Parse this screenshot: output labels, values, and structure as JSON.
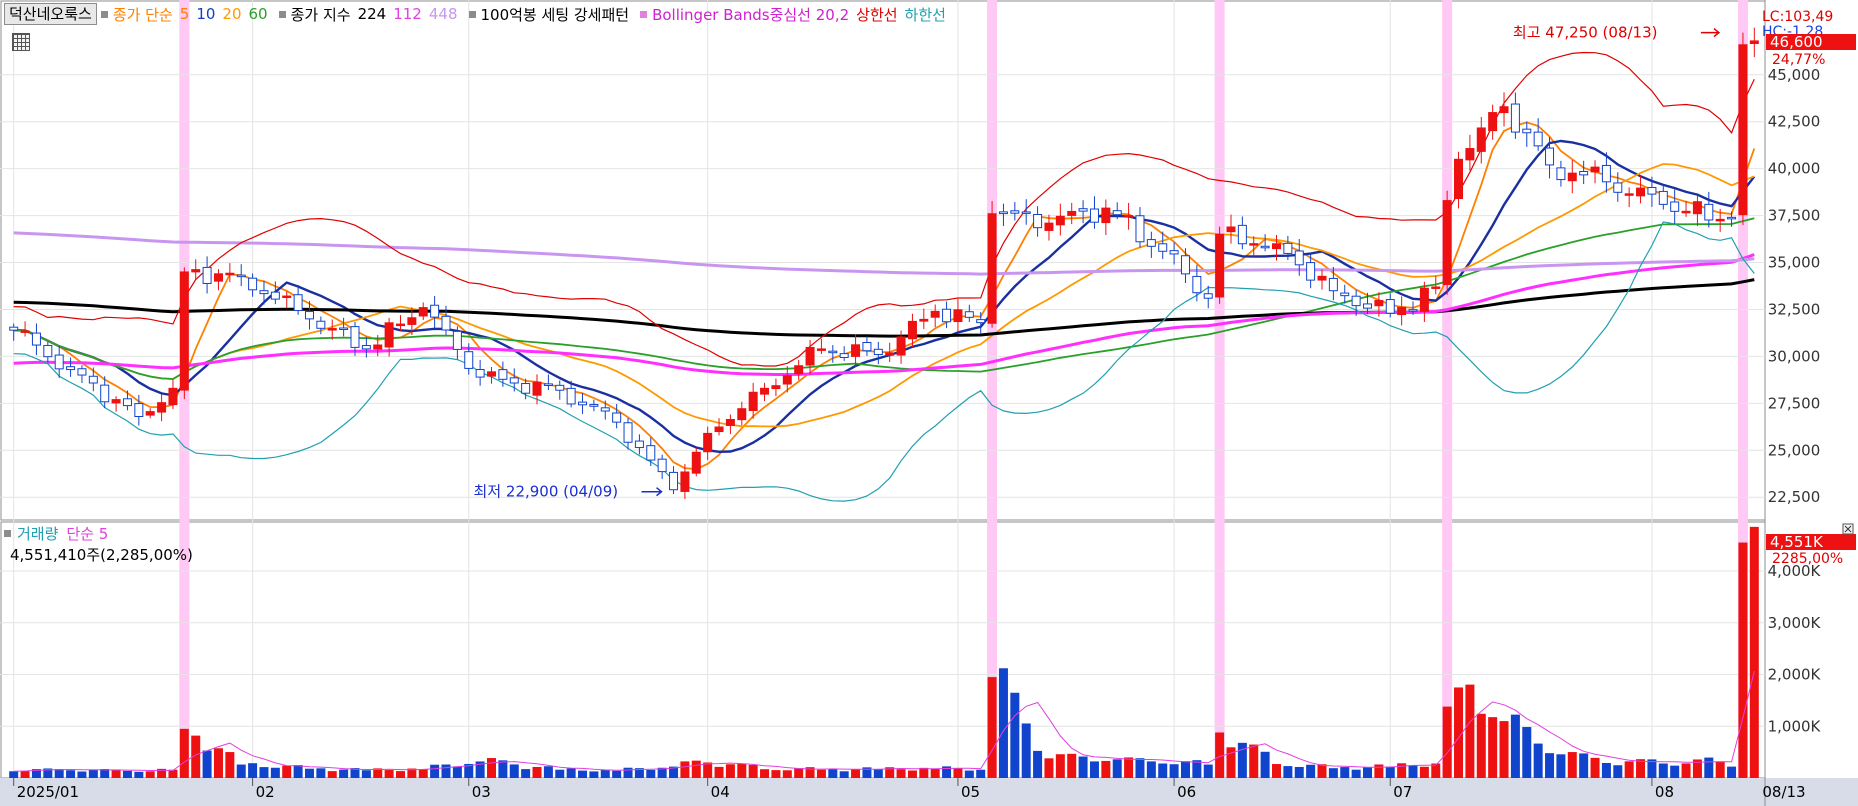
{
  "indicators": {
    "stock_name": "덕산네오룩스",
    "ma_label": "종가 단순",
    "ma_periods": [
      {
        "text": "5",
        "color": "#ff7f00"
      },
      {
        "text": "10",
        "color": "#1040c8"
      },
      {
        "text": "20",
        "color": "#ff9900"
      },
      {
        "text": "60",
        "color": "#2aa02a"
      }
    ],
    "index_label": "종가 지수",
    "index_periods": [
      {
        "text": "224",
        "color": "#000000"
      },
      {
        "text": "112",
        "color": "#e040e0"
      },
      {
        "text": "448",
        "color": "#c896f0"
      }
    ],
    "pattern_label": "100억봉 세팅 강세패턴",
    "bb_label": "Bollinger Bands중심선 20,2",
    "bb_upper_label": "상한선",
    "bb_lower_label": "하한선",
    "colors": {
      "bb_label": "#d020d0",
      "bb_upper": "#e00000",
      "bb_lower": "#20a0b0"
    }
  },
  "volume_panel": {
    "label": "거래량",
    "ma_label": "단순 5",
    "summary": "4,551,410주(2,285,00%)",
    "current_value": "4,551K",
    "current_pct": "2285,00%"
  },
  "price_panel": {
    "lc_label": "LC:103,49",
    "hc_label": "HC:-1.28",
    "current_price": "46,600",
    "current_pct": "24,77%",
    "high_annotation": "최고 47,250 (08/13)",
    "low_annotation": "최저 22,900 (04/09)"
  },
  "chart_data": {
    "type": "candlestick",
    "y_ticks": [
      45000,
      42500,
      40000,
      37500,
      35000,
      32500,
      30000,
      27500,
      25000,
      22500
    ],
    "y_tick_labels": [
      "45,000",
      "42,500",
      "40,000",
      "37,500",
      "35,000",
      "32,500",
      "30,000",
      "27,500",
      "25,000",
      "22,500"
    ],
    "ylim": [
      21500,
      47600
    ],
    "vol_ticks": [
      1000,
      2000,
      3000,
      4000
    ],
    "vol_tick_labels": [
      "1,000K",
      "2,000K",
      "3,000K",
      "4,000K"
    ],
    "vol_ylim": [
      0,
      4600
    ],
    "x_labels": [
      {
        "index": 0,
        "text": "2025/01"
      },
      {
        "index": 21,
        "text": "02"
      },
      {
        "index": 40,
        "text": "03"
      },
      {
        "index": 61,
        "text": "04"
      },
      {
        "index": 83,
        "text": "05"
      },
      {
        "index": 102,
        "text": "06"
      },
      {
        "index": 121,
        "text": "07"
      },
      {
        "index": 144,
        "text": "08"
      },
      {
        "index": 153,
        "text": "08/13"
      }
    ],
    "highlight_indices": [
      15,
      86,
      106,
      126,
      152
    ],
    "anchors": [
      {
        "i": 0,
        "c": 31400,
        "v": 130
      },
      {
        "i": 5,
        "c": 29300,
        "v": 150
      },
      {
        "i": 11,
        "c": 26800,
        "v": 120
      },
      {
        "i": 14,
        "c": 28300,
        "v": 160
      },
      {
        "i": 15,
        "c": 34500,
        "v": 950
      },
      {
        "i": 20,
        "c": 34300,
        "v": 260
      },
      {
        "i": 26,
        "c": 32000,
        "v": 180
      },
      {
        "i": 31,
        "c": 30400,
        "v": 150
      },
      {
        "i": 36,
        "c": 32600,
        "v": 170
      },
      {
        "i": 41,
        "c": 28900,
        "v": 320
      },
      {
        "i": 48,
        "c": 28200,
        "v": 160
      },
      {
        "i": 53,
        "c": 26500,
        "v": 140
      },
      {
        "i": 58,
        "c": 22900,
        "v": 220
      },
      {
        "i": 61,
        "c": 25900,
        "v": 300
      },
      {
        "i": 66,
        "c": 28300,
        "v": 170
      },
      {
        "i": 71,
        "c": 30400,
        "v": 160
      },
      {
        "i": 76,
        "c": 30100,
        "v": 170
      },
      {
        "i": 81,
        "c": 32400,
        "v": 180
      },
      {
        "i": 85,
        "c": 31800,
        "v": 160
      },
      {
        "i": 86,
        "c": 37600,
        "v": 1950
      },
      {
        "i": 91,
        "c": 37100,
        "v": 380
      },
      {
        "i": 96,
        "c": 37900,
        "v": 330
      },
      {
        "i": 101,
        "c": 35600,
        "v": 280
      },
      {
        "i": 105,
        "c": 33100,
        "v": 260
      },
      {
        "i": 106,
        "c": 36500,
        "v": 880
      },
      {
        "i": 111,
        "c": 36000,
        "v": 270
      },
      {
        "i": 116,
        "c": 33500,
        "v": 190
      },
      {
        "i": 121,
        "c": 32300,
        "v": 220
      },
      {
        "i": 125,
        "c": 33700,
        "v": 280
      },
      {
        "i": 126,
        "c": 38300,
        "v": 1380
      },
      {
        "i": 127,
        "c": 40500,
        "v": 1750
      },
      {
        "i": 131,
        "c": 43300,
        "v": 1100
      },
      {
        "i": 135,
        "c": 40200,
        "v": 480
      },
      {
        "i": 140,
        "c": 39300,
        "v": 290
      },
      {
        "i": 145,
        "c": 38100,
        "v": 280
      },
      {
        "i": 150,
        "c": 37300,
        "v": 310
      },
      {
        "i": 151,
        "c": 37400,
        "v": 220
      },
      {
        "i": 152,
        "c": 46600,
        "v": 4551
      }
    ],
    "session_high": {
      "index": 152,
      "value": 47250
    },
    "session_low": {
      "index": 58,
      "value": 22900
    },
    "series": [
      {
        "name": "5",
        "color": "#ff7f00",
        "kind": "sma",
        "period": 5
      },
      {
        "name": "10",
        "color": "#1a2fa0",
        "kind": "sma",
        "period": 10
      },
      {
        "name": "20",
        "color": "#ff9900",
        "kind": "sma",
        "period": 20
      },
      {
        "name": "60",
        "color": "#2aa02a",
        "kind": "sma",
        "period": 60
      },
      {
        "name": "224",
        "color": "#000000",
        "kind": "ema",
        "period": 224
      },
      {
        "name": "112",
        "color": "#ff30ff",
        "kind": "ema",
        "period": 112
      },
      {
        "name": "448",
        "color": "#c896f0",
        "kind": "ema",
        "period": 448
      },
      {
        "name": "상한선",
        "color": "#e00000",
        "kind": "bb_upper",
        "period": 20
      },
      {
        "name": "하한선",
        "color": "#20a0b0",
        "kind": "bb_lower",
        "period": 20
      }
    ],
    "colors": {
      "up": "#ee1111",
      "down": "#1144cc",
      "highlight": "#ffc8f5",
      "vol_ma": "#e040e0"
    }
  }
}
